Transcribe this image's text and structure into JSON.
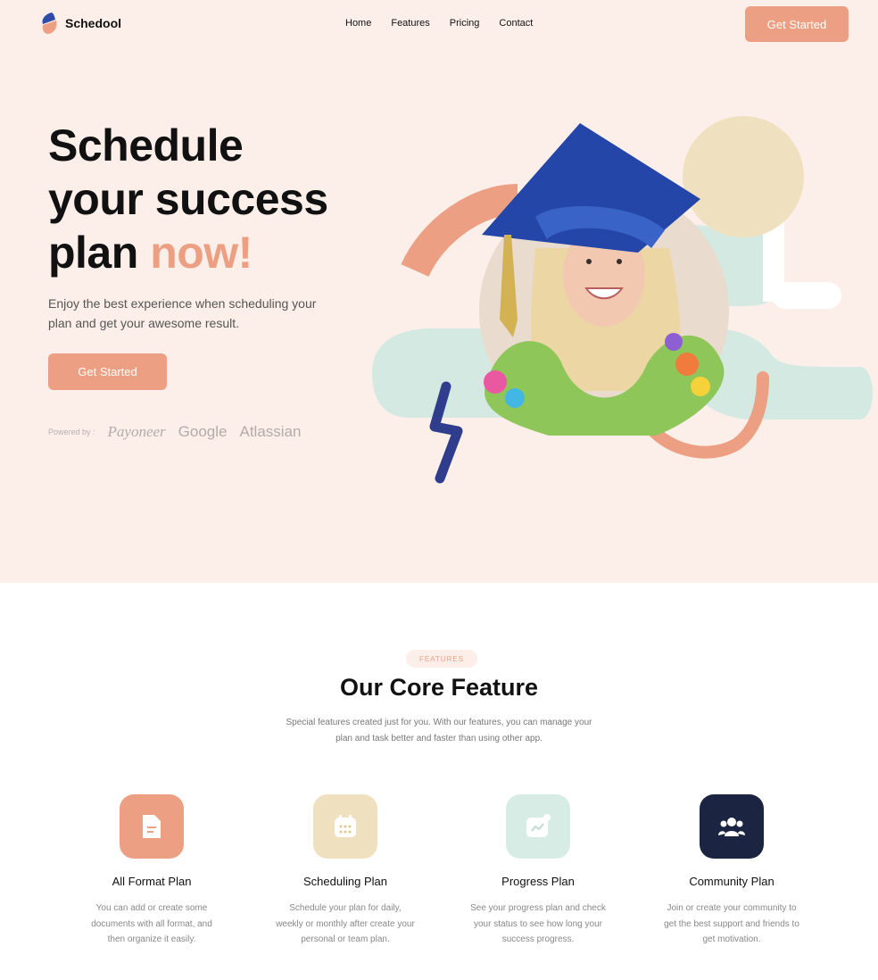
{
  "header": {
    "brand": "Schedool",
    "nav": [
      "Home",
      "Features",
      "Pricing",
      "Contact"
    ],
    "cta": "Get Started"
  },
  "hero": {
    "headline_line1": "Schedule",
    "headline_line2": "your success",
    "headline_line3_prefix": "plan ",
    "headline_line3_accent": "now!",
    "lede": "Enjoy the best experience when scheduling your plan and get your awesome result.",
    "cta": "Get Started",
    "powered_label": "Powered by :",
    "partners": [
      "Payoneer",
      "Google",
      "Atlassian"
    ]
  },
  "features": {
    "tag": "FEATURES",
    "title": "Our Core Feature",
    "subtitle": "Special features created just for you. With our features, you can manage your plan and task better and faster than using other app.",
    "items": [
      {
        "title": "All Format Plan",
        "desc": "You can add or create some documents with all format, and then organize it easily.",
        "icon": "document-icon",
        "color": "#ec9f82"
      },
      {
        "title": "Scheduling Plan",
        "desc": "Schedule your plan for daily, weekly or monthly after create your personal or team plan.",
        "icon": "calendar-icon",
        "color": "#efe0bf"
      },
      {
        "title": "Progress Plan",
        "desc": "See your progress plan and check your status to see how long your success progress.",
        "icon": "chart-icon",
        "color": "#d8ece6"
      },
      {
        "title": "Community Plan",
        "desc": "Join or create your community to get the best support and friends to get motivation.",
        "icon": "community-icon",
        "color": "#1b2541"
      }
    ]
  },
  "colors": {
    "accent": "#ec9f82",
    "hero_bg": "#fcefe9",
    "navy": "#1b2541",
    "mint": "#d3e9e2",
    "sand": "#efe0bf",
    "blue": "#2f4da6"
  }
}
